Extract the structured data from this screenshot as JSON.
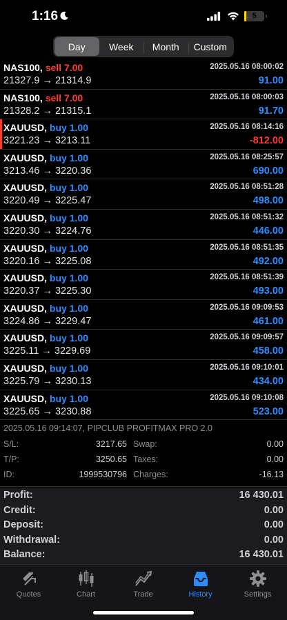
{
  "status_bar": {
    "time": "1:16",
    "battery_level": "5"
  },
  "period_tabs": [
    {
      "label": "Day",
      "active": true
    },
    {
      "label": "Week",
      "active": false
    },
    {
      "label": "Month",
      "active": false
    },
    {
      "label": "Custom",
      "active": false
    }
  ],
  "deals": [
    {
      "symbol": "NAS100,",
      "side": "sell",
      "side_label": "sell 7.00",
      "time": "2025.05.16 08:00:02",
      "prices": "21327.9 → 21314.9",
      "profit": "91.00"
    },
    {
      "symbol": "NAS100,",
      "side": "sell",
      "side_label": "sell 7.00",
      "time": "2025.05.16 08:00:03",
      "prices": "21328.2 → 21315.1",
      "profit": "91.70"
    },
    {
      "symbol": "XAUUSD,",
      "side": "buy",
      "side_label": "buy 1.00",
      "time": "2025.05.16 08:14:16",
      "prices": "3221.23 → 3213.11",
      "profit": "-812.00"
    },
    {
      "symbol": "XAUUSD,",
      "side": "buy",
      "side_label": "buy 1.00",
      "time": "2025.05.16 08:25:57",
      "prices": "3213.46 → 3220.36",
      "profit": "690.00"
    },
    {
      "symbol": "XAUUSD,",
      "side": "buy",
      "side_label": "buy 1.00",
      "time": "2025.05.16 08:51:28",
      "prices": "3220.49 → 3225.47",
      "profit": "498.00"
    },
    {
      "symbol": "XAUUSD,",
      "side": "buy",
      "side_label": "buy 1.00",
      "time": "2025.05.16 08:51:32",
      "prices": "3220.30 → 3224.76",
      "profit": "446.00"
    },
    {
      "symbol": "XAUUSD,",
      "side": "buy",
      "side_label": "buy 1.00",
      "time": "2025.05.16 08:51:35",
      "prices": "3220.16 → 3225.08",
      "profit": "492.00"
    },
    {
      "symbol": "XAUUSD,",
      "side": "buy",
      "side_label": "buy 1.00",
      "time": "2025.05.16 08:51:39",
      "prices": "3220.37 → 3225.30",
      "profit": "493.00"
    },
    {
      "symbol": "XAUUSD,",
      "side": "buy",
      "side_label": "buy 1.00",
      "time": "2025.05.16 09:09:53",
      "prices": "3224.86 → 3229.47",
      "profit": "461.00"
    },
    {
      "symbol": "XAUUSD,",
      "side": "buy",
      "side_label": "buy 1.00",
      "time": "2025.05.16 09:09:57",
      "prices": "3225.11 → 3229.69",
      "profit": "458.00"
    },
    {
      "symbol": "XAUUSD,",
      "side": "buy",
      "side_label": "buy 1.00",
      "time": "2025.05.16 09:10:01",
      "prices": "3225.79 → 3230.13",
      "profit": "434.00"
    },
    {
      "symbol": "XAUUSD,",
      "side": "buy",
      "side_label": "buy 1.00",
      "time": "2025.05.16 09:10:08",
      "prices": "3225.65 → 3230.88",
      "profit": "523.00"
    }
  ],
  "detail": {
    "header": "2025.05.16 09:14:07, PIPCLUB PROFITMAX PRO 2.0",
    "sl_label": "S/L:",
    "sl_value": "3217.65",
    "swap_label": "Swap:",
    "swap_value": "0.00",
    "tp_label": "T/P:",
    "tp_value": "3250.65",
    "taxes_label": "Taxes:",
    "taxes_value": "0.00",
    "id_label": "ID:",
    "id_value": "1999530796",
    "charges_label": "Charges:",
    "charges_value": "-16.13"
  },
  "summary": [
    {
      "label": "Profit:",
      "value": "16 430.01"
    },
    {
      "label": "Credit:",
      "value": "0.00"
    },
    {
      "label": "Deposit:",
      "value": "0.00"
    },
    {
      "label": "Withdrawal:",
      "value": "0.00"
    },
    {
      "label": "Balance:",
      "value": "16 430.01"
    }
  ],
  "tabbar": [
    {
      "label": "Quotes",
      "icon": "quotes-icon"
    },
    {
      "label": "Chart",
      "icon": "chart-icon"
    },
    {
      "label": "Trade",
      "icon": "trade-icon"
    },
    {
      "label": "History",
      "icon": "history-icon",
      "active": true
    },
    {
      "label": "Settings",
      "icon": "gear-icon"
    }
  ],
  "colors": {
    "buy": "#2f8cff",
    "sell": "#ff3b30",
    "accent": "#2f8cff",
    "battery": "#ffd60a"
  }
}
